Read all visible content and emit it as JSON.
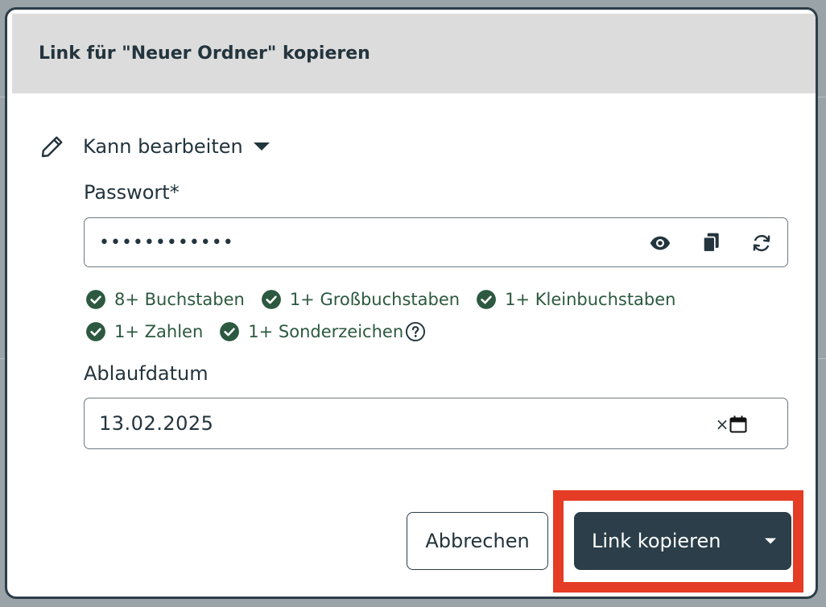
{
  "dialog": {
    "title": "Link für \"Neuer Ordner\" kopieren"
  },
  "permission": {
    "label": "Kann bearbeiten",
    "icon": "pencil-icon"
  },
  "password": {
    "label": "Passwort*",
    "value": "••••••••••••",
    "icons": [
      "eye-icon",
      "copy-icon",
      "refresh-icon"
    ]
  },
  "requirements": [
    {
      "label": "8+ Buchstaben",
      "met": true
    },
    {
      "label": "1+ Großbuchstaben",
      "met": true
    },
    {
      "label": "1+ Kleinbuchstaben",
      "met": true
    },
    {
      "label": "1+ Zahlen",
      "met": true
    },
    {
      "label": "1+ Sonderzeichen",
      "met": true
    }
  ],
  "expiry": {
    "label": "Ablaufdatum",
    "value": "13.02.2025",
    "clear_glyph": "×",
    "icons": [
      "calendar-icon"
    ]
  },
  "buttons": {
    "cancel": "Abbrechen",
    "primary": "Link kopieren"
  },
  "colors": {
    "primary": "#2b3e49",
    "success": "#2c5940",
    "highlight": "#e43c25",
    "header_bg": "#dcdcdc"
  }
}
